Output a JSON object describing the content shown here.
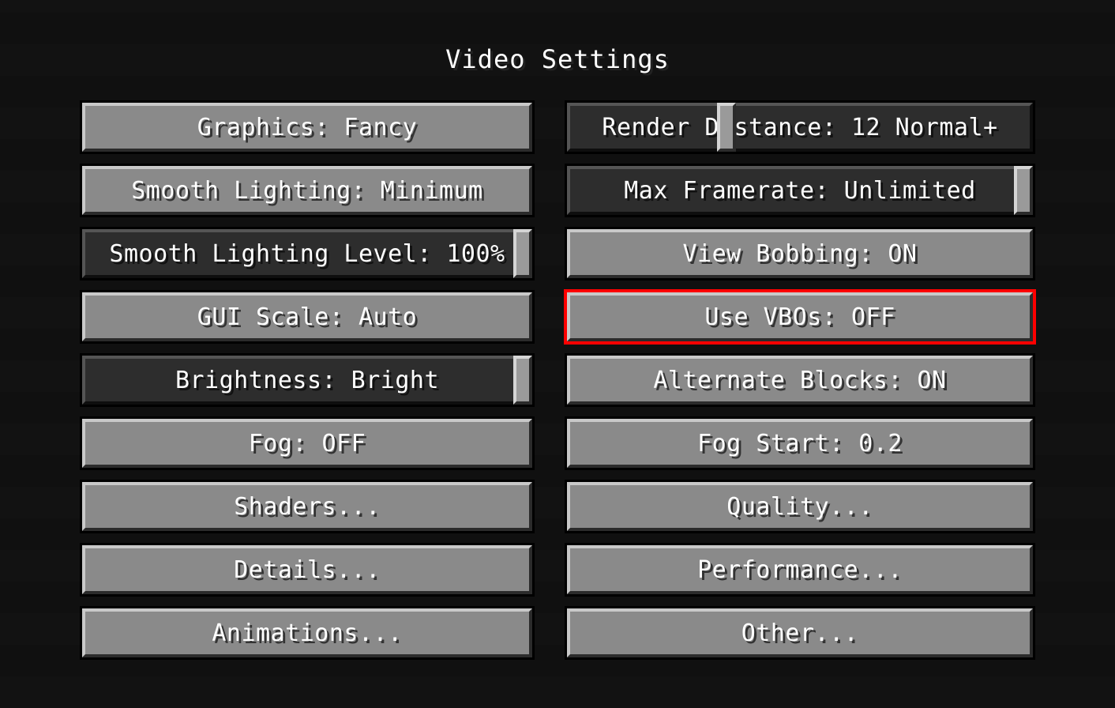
{
  "title": "Video Settings",
  "left": {
    "graphics": "Graphics: Fancy",
    "smooth_lighting": "Smooth Lighting: Minimum",
    "smooth_lighting_level": "Smooth Lighting Level: 100%",
    "gui_scale": "GUI Scale: Auto",
    "brightness": "Brightness: Bright",
    "fog": "Fog: OFF",
    "shaders": "Shaders...",
    "details": "Details...",
    "animations": "Animations..."
  },
  "right": {
    "render_distance": "Render Distance: 12 Normal+",
    "max_framerate": "Max Framerate: Unlimited",
    "view_bobbing": "View Bobbing: ON",
    "use_vbos": "Use VBOs: OFF",
    "alternate_blocks": "Alternate Blocks: ON",
    "fog_start": "Fog Start: 0.2",
    "quality": "Quality...",
    "performance": "Performance...",
    "other": "Other..."
  },
  "slider_positions": {
    "smooth_lighting_level_pct": 100,
    "brightness_pct": 100,
    "render_distance_pct": 32,
    "max_framerate_pct": 100
  },
  "highlighted": "use_vbos"
}
